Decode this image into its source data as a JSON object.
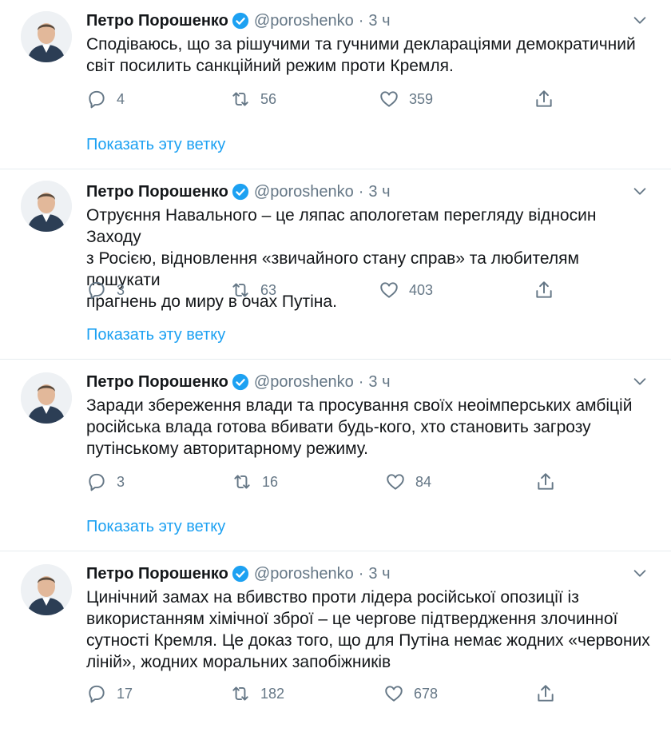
{
  "tweets": [
    {
      "name": "Петро Порошенко",
      "handle": "@poroshenko",
      "time": "3 ч",
      "lines": [
        "Сподіваюсь, що за рішучими та гучними деклараціями демократичний",
        "світ посилить санкційний режим проти Кремля."
      ],
      "replies": "4",
      "retweets": "56",
      "likes": "359",
      "thread_link": "Показать эту ветку"
    },
    {
      "name": "Петро Порошенко",
      "handle": "@poroshenko",
      "time": "3 ч",
      "lines": [
        "Отруєння Навального – це ляпас апологетам перегляду відносин Заходу",
        "з Росією, відновлення «звичайного стану справ» та любителям пошукати",
        "прагнень до миру в очах Путіна."
      ],
      "replies": "3",
      "retweets": "63",
      "likes": "403",
      "thread_link": "Показать эту ветку"
    },
    {
      "name": "Петро Порошенко",
      "handle": "@poroshenko",
      "time": "3 ч",
      "lines": [
        "Заради збереження влади та просування своїх неоімперських амбіцій",
        "російська влада готова вбивати будь-кого, хто становить загрозу",
        "путінському авторитарному режиму."
      ],
      "replies": "3",
      "retweets": "16",
      "likes": "84",
      "thread_link": "Показать эту ветку"
    },
    {
      "name": "Петро Порошенко",
      "handle": "@poroshenko",
      "time": "3 ч",
      "lines": [
        "Цинічний замах на вбивство проти лідера російської опозиції із",
        "використанням хімічної зброї – це чергове підтвердження злочинної",
        "сутності Кремля. Це доказ того, що для Путіна немає жодних «червоних",
        "ліній», жодних моральних запобіжників"
      ],
      "replies": "17",
      "retweets": "182",
      "likes": "678"
    }
  ],
  "colors": {
    "accent": "#1da1f2",
    "muted": "#657786",
    "verified": "#1da1f2",
    "divider": "#e6ecf0"
  },
  "icons": [
    "avatar",
    "verified-badge-icon",
    "chevron-down-icon",
    "reply-icon",
    "retweet-icon",
    "like-icon",
    "share-icon"
  ]
}
